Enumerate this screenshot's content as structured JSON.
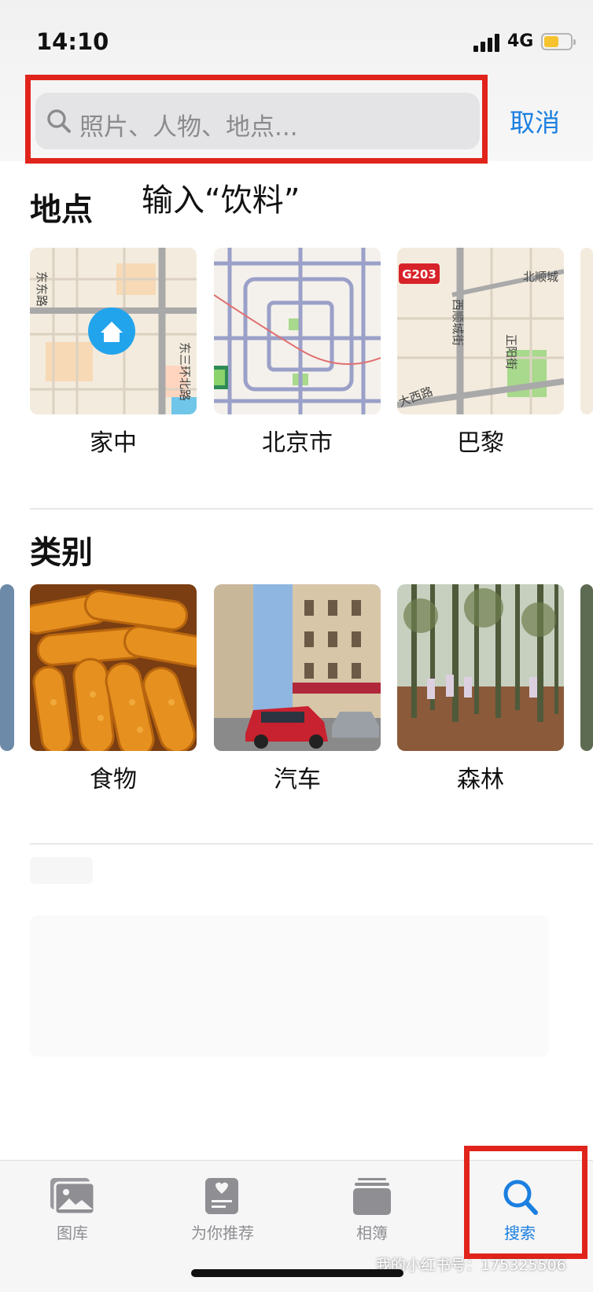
{
  "status_bar": {
    "time": "14:10",
    "network": "4G"
  },
  "search": {
    "placeholder": "照片、人物、地点...",
    "cancel_label": "取消"
  },
  "annotation": "输入“饮料”",
  "places": {
    "title": "地点",
    "items": [
      {
        "label": "家中",
        "map_text": [
          "东东路",
          "东三环北路"
        ]
      },
      {
        "label": "北京市"
      },
      {
        "label": "巴黎",
        "map_text": [
          "G203",
          "北顺城",
          "西顺城街",
          "正阳街",
          "大西路"
        ]
      }
    ]
  },
  "categories": {
    "title": "类别",
    "items": [
      {
        "label": "食物"
      },
      {
        "label": "汽车"
      },
      {
        "label": "森林"
      }
    ]
  },
  "tab_bar": {
    "items": [
      {
        "label": "图库",
        "icon": "photo-library-icon"
      },
      {
        "label": "为你推荐",
        "icon": "for-you-icon"
      },
      {
        "label": "相簿",
        "icon": "albums-icon"
      },
      {
        "label": "搜索",
        "icon": "search-icon",
        "active": true
      }
    ]
  },
  "watermark": "我的小红书号：175325506",
  "colors": {
    "accent_blue": "#1b7fe0",
    "highlight_red": "#e1241b",
    "battery_yellow": "#f6c32f"
  }
}
